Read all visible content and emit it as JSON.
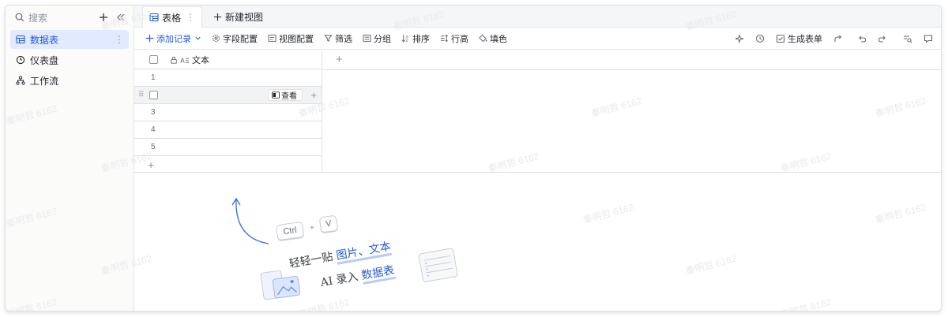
{
  "sidebar": {
    "search_label": "搜索",
    "items": [
      {
        "label": "数据表",
        "active": true
      },
      {
        "label": "仪表盘",
        "active": false
      },
      {
        "label": "工作流",
        "active": false
      }
    ]
  },
  "tabs": {
    "active_label": "表格",
    "add_label": "新建视图"
  },
  "toolbar": {
    "add_record": "添加记录",
    "field_config": "字段配置",
    "view_config": "视图配置",
    "filter": "筛选",
    "group": "分组",
    "sort": "排序",
    "row_height": "行高",
    "fill_color": "填色",
    "generate_form": "生成表单"
  },
  "grid": {
    "field_name": "文本",
    "row_numbers": [
      "1",
      "",
      "3",
      "4",
      "5"
    ],
    "view_button": "查看"
  },
  "empty_hint": {
    "key_ctrl": "Ctrl",
    "key_plus": "+",
    "key_v": "V",
    "line1_prefix": "轻轻一贴 ",
    "line1_highlight": "图片、文本",
    "line2_prefix": "AI 录入 ",
    "line2_highlight": "数据表"
  },
  "watermark": "秦明哲 6162",
  "colors": {
    "accent": "#245bdb",
    "active_bg": "#e1eaff",
    "border": "#dee0e3"
  }
}
